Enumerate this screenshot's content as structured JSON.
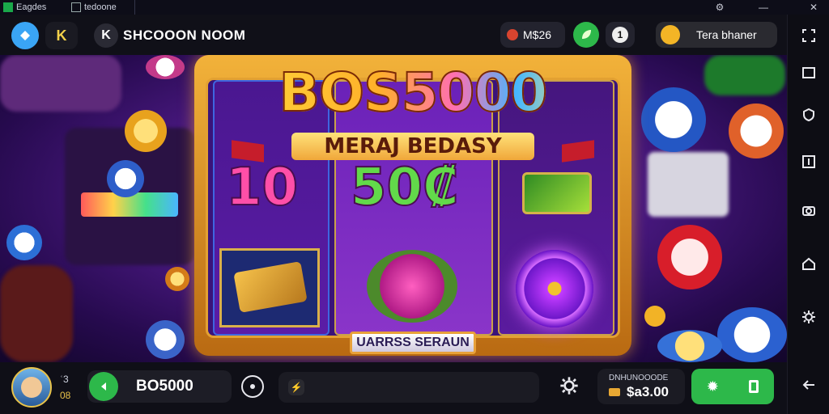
{
  "os": {
    "tab1_label": "Eagdes",
    "tab2_label": "tedoone",
    "ctrl_icons": [
      "settings-icon",
      "minimize-icon",
      "close-icon"
    ]
  },
  "topbar": {
    "game_title": "SHCOOON NOOM",
    "currency1_value": "M$26",
    "currency2_value": "1",
    "promo_label": "Tera bhaner"
  },
  "reels": {
    "title": "BOS5000",
    "subtitle": "MERAJ BEDASY",
    "reel1_value": "10",
    "reel2_value": "50₡",
    "bottom_badge": "UARRSS SERAUN"
  },
  "bottombar": {
    "player_small_top": "ʿ3",
    "player_small_bottom": "08",
    "code_value": "BO5000",
    "balance_label": "DNHUNOOODE",
    "balance_value": "$a3.00"
  },
  "colors": {
    "accent_green": "#2db84a",
    "frame_gold": "#f2b23a",
    "scene_purple": "#4d1a86"
  }
}
